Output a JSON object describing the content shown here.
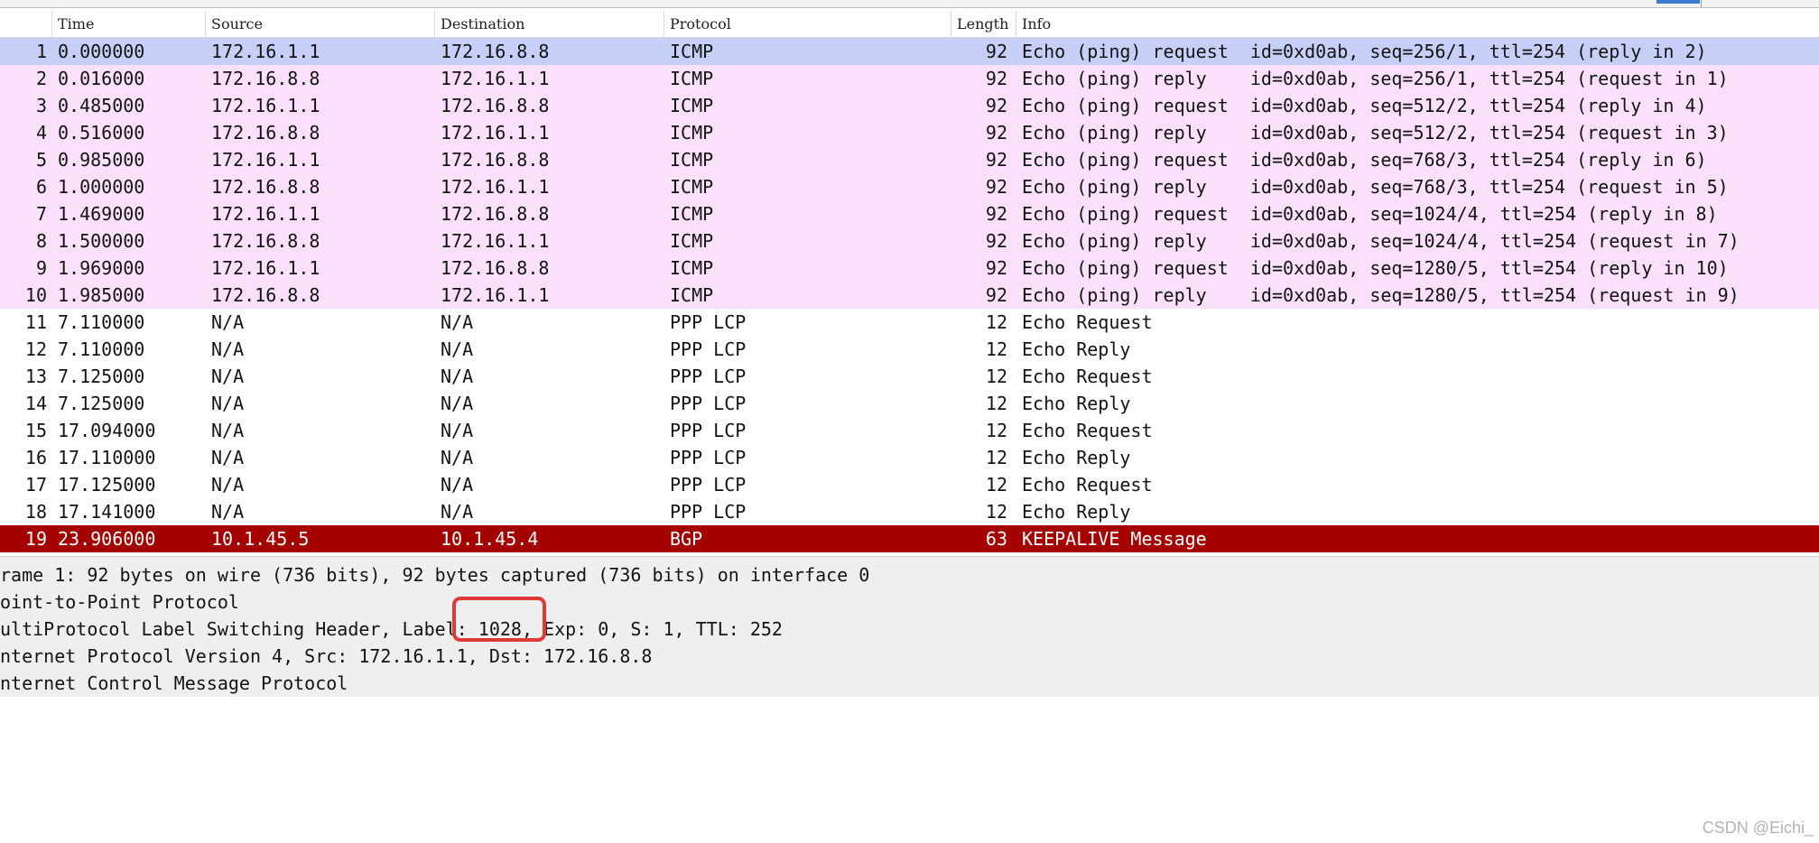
{
  "columns": {
    "time": "Time",
    "source": "Source",
    "destination": "Destination",
    "protocol": "Protocol",
    "length": "Length",
    "info": "Info"
  },
  "packets": [
    {
      "no": "1",
      "time": "0.000000",
      "source": "172.16.1.1",
      "destination": "172.16.8.8",
      "protocol": "ICMP",
      "length": "92",
      "info": "Echo (ping) request  id=0xd0ab, seq=256/1, ttl=254 (reply in 2)"
    },
    {
      "no": "2",
      "time": "0.016000",
      "source": "172.16.8.8",
      "destination": "172.16.1.1",
      "protocol": "ICMP",
      "length": "92",
      "info": "Echo (ping) reply    id=0xd0ab, seq=256/1, ttl=254 (request in 1)"
    },
    {
      "no": "3",
      "time": "0.485000",
      "source": "172.16.1.1",
      "destination": "172.16.8.8",
      "protocol": "ICMP",
      "length": "92",
      "info": "Echo (ping) request  id=0xd0ab, seq=512/2, ttl=254 (reply in 4)"
    },
    {
      "no": "4",
      "time": "0.516000",
      "source": "172.16.8.8",
      "destination": "172.16.1.1",
      "protocol": "ICMP",
      "length": "92",
      "info": "Echo (ping) reply    id=0xd0ab, seq=512/2, ttl=254 (request in 3)"
    },
    {
      "no": "5",
      "time": "0.985000",
      "source": "172.16.1.1",
      "destination": "172.16.8.8",
      "protocol": "ICMP",
      "length": "92",
      "info": "Echo (ping) request  id=0xd0ab, seq=768/3, ttl=254 (reply in 6)"
    },
    {
      "no": "6",
      "time": "1.000000",
      "source": "172.16.8.8",
      "destination": "172.16.1.1",
      "protocol": "ICMP",
      "length": "92",
      "info": "Echo (ping) reply    id=0xd0ab, seq=768/3, ttl=254 (request in 5)"
    },
    {
      "no": "7",
      "time": "1.469000",
      "source": "172.16.1.1",
      "destination": "172.16.8.8",
      "protocol": "ICMP",
      "length": "92",
      "info": "Echo (ping) request  id=0xd0ab, seq=1024/4, ttl=254 (reply in 8)"
    },
    {
      "no": "8",
      "time": "1.500000",
      "source": "172.16.8.8",
      "destination": "172.16.1.1",
      "protocol": "ICMP",
      "length": "92",
      "info": "Echo (ping) reply    id=0xd0ab, seq=1024/4, ttl=254 (request in 7)"
    },
    {
      "no": "9",
      "time": "1.969000",
      "source": "172.16.1.1",
      "destination": "172.16.8.8",
      "protocol": "ICMP",
      "length": "92",
      "info": "Echo (ping) request  id=0xd0ab, seq=1280/5, ttl=254 (reply in 10)"
    },
    {
      "no": "10",
      "time": "1.985000",
      "source": "172.16.8.8",
      "destination": "172.16.1.1",
      "protocol": "ICMP",
      "length": "92",
      "info": "Echo (ping) reply    id=0xd0ab, seq=1280/5, ttl=254 (request in 9)"
    },
    {
      "no": "11",
      "time": "7.110000",
      "source": "N/A",
      "destination": "N/A",
      "protocol": "PPP LCP",
      "length": "12",
      "info": "Echo Request"
    },
    {
      "no": "12",
      "time": "7.110000",
      "source": "N/A",
      "destination": "N/A",
      "protocol": "PPP LCP",
      "length": "12",
      "info": "Echo Reply"
    },
    {
      "no": "13",
      "time": "7.125000",
      "source": "N/A",
      "destination": "N/A",
      "protocol": "PPP LCP",
      "length": "12",
      "info": "Echo Request"
    },
    {
      "no": "14",
      "time": "7.125000",
      "source": "N/A",
      "destination": "N/A",
      "protocol": "PPP LCP",
      "length": "12",
      "info": "Echo Reply"
    },
    {
      "no": "15",
      "time": "17.094000",
      "source": "N/A",
      "destination": "N/A",
      "protocol": "PPP LCP",
      "length": "12",
      "info": "Echo Request"
    },
    {
      "no": "16",
      "time": "17.110000",
      "source": "N/A",
      "destination": "N/A",
      "protocol": "PPP LCP",
      "length": "12",
      "info": "Echo Reply"
    },
    {
      "no": "17",
      "time": "17.125000",
      "source": "N/A",
      "destination": "N/A",
      "protocol": "PPP LCP",
      "length": "12",
      "info": "Echo Request"
    },
    {
      "no": "18",
      "time": "17.141000",
      "source": "N/A",
      "destination": "N/A",
      "protocol": "PPP LCP",
      "length": "12",
      "info": "Echo Reply"
    },
    {
      "no": "19",
      "time": "23.906000",
      "source": "10.1.45.5",
      "destination": "10.1.45.4",
      "protocol": "BGP",
      "length": "63",
      "info": "KEEPALIVE Message"
    }
  ],
  "details": [
    "rame 1: 92 bytes on wire (736 bits), 92 bytes captured (736 bits) on interface 0",
    "oint-to-Point Protocol",
    "ultiProtocol Label Switching Header, Label: 1028, Exp: 0, S: 1, TTL: 252",
    "nternet Protocol Version 4, Src: 172.16.1.1, Dst: 172.16.8.8",
    "nternet Control Message Protocol"
  ],
  "watermark": "CSDN @Eichi_",
  "colors": {
    "selected_row": "#c7cff7",
    "icmp_row": "#fae0fb",
    "bgp_row": "#a40000",
    "highlight_box": "#e0393b"
  }
}
